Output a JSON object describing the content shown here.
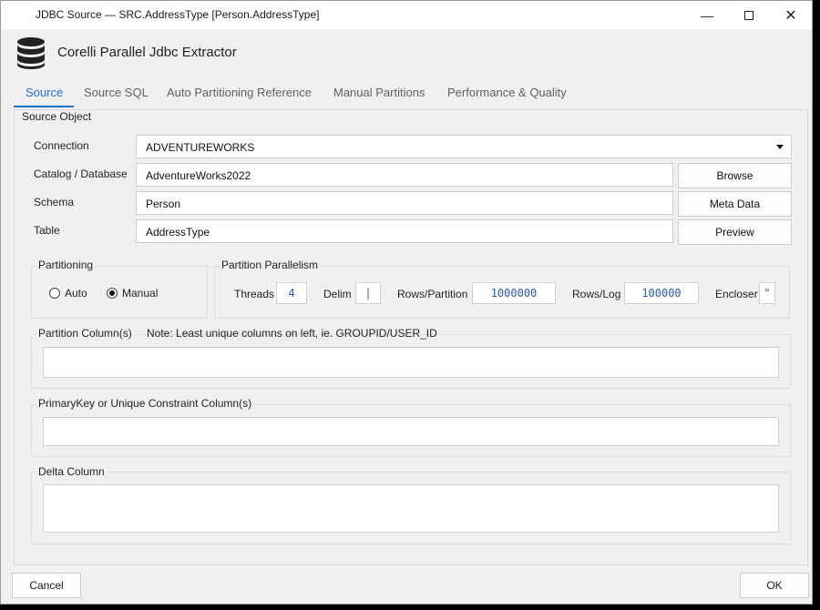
{
  "window": {
    "title": "JDBC Source — SRC.AddressType  [Person.AddressType]"
  },
  "header": {
    "app_name": "Corelli Parallel Jdbc Extractor"
  },
  "tabs": [
    {
      "label": "Source"
    },
    {
      "label": "Source SQL"
    },
    {
      "label": "Auto Partitioning Reference"
    },
    {
      "label": "Manual Partitions"
    },
    {
      "label": "Performance & Quality"
    }
  ],
  "source_object": {
    "group_label": "Source Object",
    "connection_label": "Connection",
    "connection_value": "ADVENTUREWORKS",
    "catalog_label": "Catalog / Database",
    "catalog_value": "AdventureWorks2022",
    "schema_label": "Schema",
    "schema_value": "Person",
    "table_label": "Table",
    "table_value": "AddressType",
    "browse_label": "Browse",
    "metadata_label": "Meta Data",
    "preview_label": "Preview"
  },
  "partitioning": {
    "group_label": "Partitioning",
    "auto_label": "Auto",
    "manual_label": "Manual",
    "selected": "Manual"
  },
  "parallelism": {
    "group_label": "Partition Parallelism",
    "threads_label": "Threads",
    "threads_value": "4",
    "delim_label": "Delim",
    "delim_value": "|",
    "rows_partition_label": "Rows/Partition",
    "rows_partition_value": "1000000",
    "rows_log_label": "Rows/Log",
    "rows_log_value": "100000",
    "encloser_label": "Encloser",
    "encloser_value": "\""
  },
  "partition_columns": {
    "group_label": "Partition Column(s)",
    "note": "Note: Least unique columns on left, ie. GROUPID/USER_ID"
  },
  "primary_key": {
    "group_label": "PrimaryKey or Unique Constraint Column(s)"
  },
  "delta": {
    "group_label": "Delta Column"
  },
  "footer": {
    "cancel_label": "Cancel",
    "ok_label": "OK"
  }
}
